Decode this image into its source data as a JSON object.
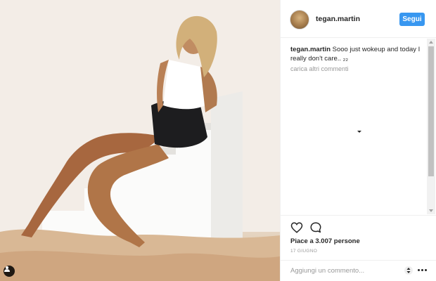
{
  "post": {
    "username": "tegan.martin",
    "follow_label": "Segui",
    "caption_user": "tegan.martin",
    "caption_text": "Sooo just wokeup and today I really don't care.. ₂₂",
    "load_more_label": "carica altri commenti",
    "likes_text": "Piace a 3.007 persone",
    "date_text": "17 GIUGNO",
    "comment_placeholder": "Aggiungi un commento..."
  },
  "icons": {
    "like": "heart-icon",
    "comment": "speech-bubble-icon",
    "tag": "person-tag-icon",
    "more": "ellipsis-icon",
    "sort": "up-down-arrows-icon"
  },
  "colors": {
    "follow_button": "#3897f0",
    "secondary_text": "#999999",
    "primary_text": "#262626"
  }
}
